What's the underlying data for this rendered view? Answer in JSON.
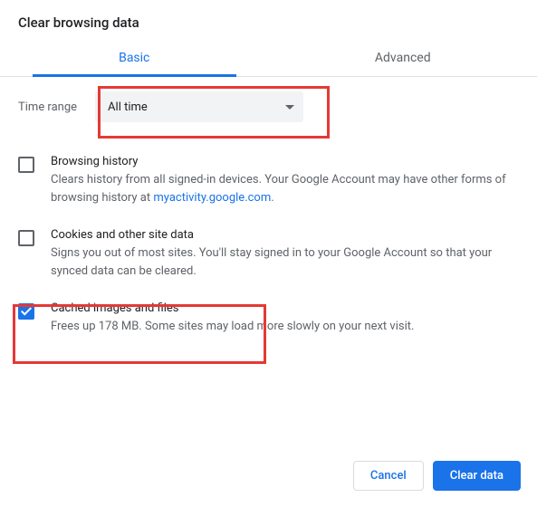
{
  "dialog": {
    "title": "Clear browsing data"
  },
  "tabs": {
    "basic": "Basic",
    "advanced": "Advanced"
  },
  "time_range": {
    "label": "Time range",
    "selected": "All time"
  },
  "items": {
    "browsing_history": {
      "title": "Browsing history",
      "desc_before": "Clears history from all signed-in devices. Your Google Account may have other forms of browsing history at ",
      "link_text": "myactivity.google.com",
      "desc_after": "."
    },
    "cookies": {
      "title": "Cookies and other site data",
      "desc": "Signs you out of most sites. You'll stay signed in to your Google Account so that your synced data can be cleared."
    },
    "cache": {
      "title": "Cached images and files",
      "desc": "Frees up 178 MB. Some sites may load more slowly on your next visit."
    }
  },
  "footer": {
    "cancel": "Cancel",
    "clear": "Clear data"
  }
}
